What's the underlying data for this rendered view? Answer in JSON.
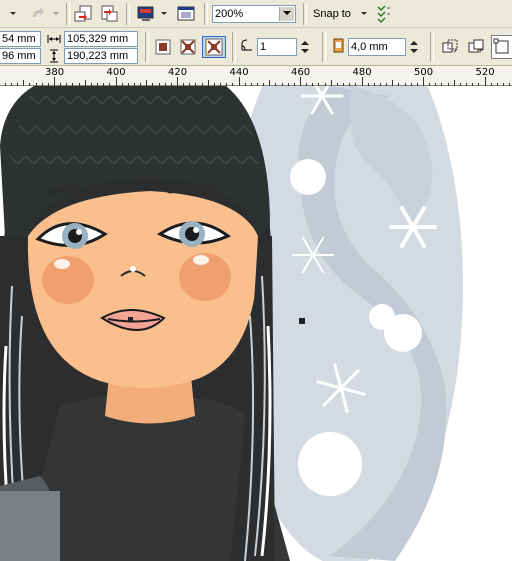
{
  "toolbar_top": {
    "zoom_value": "200%",
    "snap_label": "Snap to"
  },
  "property_bar": {
    "x_value": "54 mm",
    "y_value": "96 mm",
    "width_value": "105,329 mm",
    "height_value": "190,223 mm",
    "rotation_value": "1",
    "nudge_value": "4,0 mm"
  },
  "ruler": {
    "labels": [
      "380",
      "400",
      "420",
      "440",
      "460",
      "480",
      "500",
      "520"
    ]
  },
  "colors": {
    "toolbar_bg": "#ece9d8",
    "bubble": "#d3dae2",
    "bubble_swirl": "#c1cad5",
    "hair": "#2b2d2e",
    "skin": "#fbbf8e",
    "cheek": "#f0a06e",
    "lips": "#f4a497",
    "eye": "#99b1c1"
  },
  "icons": [
    "undo-dropdown-icon",
    "redo-icon",
    "import-icon",
    "export-icon",
    "application-launcher-icon",
    "full-screen-preview-icon",
    "snap-to-options-icon",
    "quick-corrections-icon"
  ]
}
